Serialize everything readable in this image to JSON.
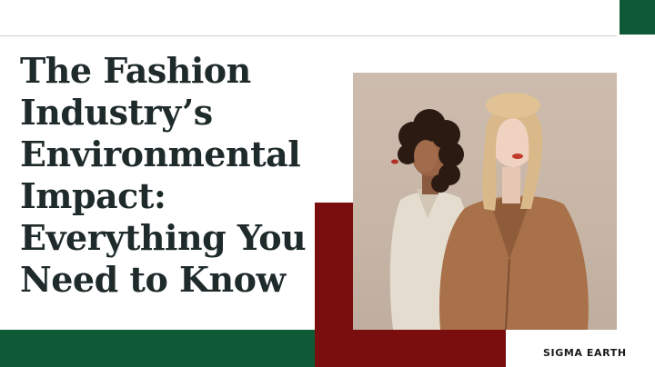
{
  "headline": {
    "lines": [
      "The Fashion",
      "Industry’s",
      "Environmental",
      "Impact:",
      "Everything You",
      "Need to Know"
    ]
  },
  "brand": {
    "name": "SIGMA EARTH"
  },
  "colors": {
    "green": "#0f5a36",
    "red": "#7a0d0d",
    "text": "#1f2a2a"
  },
  "photo": {
    "subject": "two models wearing coats"
  }
}
